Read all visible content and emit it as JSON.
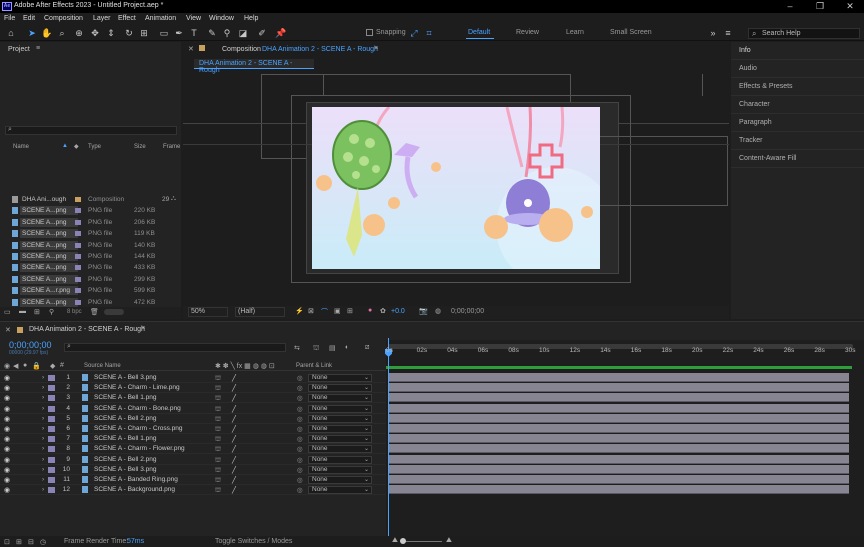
{
  "app": {
    "title": "Adobe After Effects 2023 - Untitled Project.aep *",
    "logo_text": "Ae"
  },
  "menu": [
    "File",
    "Edit",
    "Composition",
    "Layer",
    "Effect",
    "Animation",
    "View",
    "Window",
    "Help"
  ],
  "toolbar": {
    "snapping_label": "Snapping",
    "workspaces": [
      "Default",
      "Review",
      "Learn",
      "Small Screen"
    ],
    "active_workspace": "Default",
    "search_placeholder": "Search Help"
  },
  "project": {
    "title": "Project",
    "columns": {
      "name": "Name",
      "type": "Type",
      "size": "Size",
      "frame": "Frame"
    },
    "items": [
      {
        "name": "DHA Ani...ough",
        "type": "Composition",
        "size": "",
        "frame": "29",
        "kind": "comp"
      },
      {
        "name": "SCENE A...png",
        "type": "PNG file",
        "size": "220 KB",
        "frame": "",
        "kind": "png"
      },
      {
        "name": "SCENE A...png",
        "type": "PNG file",
        "size": "206 KB",
        "frame": "",
        "kind": "png"
      },
      {
        "name": "SCENE A...png",
        "type": "PNG file",
        "size": "119 KB",
        "frame": "",
        "kind": "png"
      },
      {
        "name": "SCENE A...png",
        "type": "PNG file",
        "size": "140 KB",
        "frame": "",
        "kind": "png"
      },
      {
        "name": "SCENE A...png",
        "type": "PNG file",
        "size": "144 KB",
        "frame": "",
        "kind": "png"
      },
      {
        "name": "SCENE A...png",
        "type": "PNG file",
        "size": "433 KB",
        "frame": "",
        "kind": "png"
      },
      {
        "name": "SCENE A...png",
        "type": "PNG file",
        "size": "299 KB",
        "frame": "",
        "kind": "png"
      },
      {
        "name": "SCENE A...r.png",
        "type": "PNG file",
        "size": "599 KB",
        "frame": "",
        "kind": "png"
      },
      {
        "name": "SCENE A...png",
        "type": "PNG file",
        "size": "472 KB",
        "frame": "",
        "kind": "png"
      }
    ],
    "bpc": "8 bpc"
  },
  "composition": {
    "panel_prefix": "Composition",
    "panel_name": "DHA Animation 2 - SCENE A - Rough",
    "tab_label": "DHA Animation 2 - SCENE A - Rough",
    "zoom": "50%",
    "resolution": "(Half)",
    "exposure": "+0.0",
    "timecode": "0;00;00;00"
  },
  "info_panel": {
    "items": [
      "Info",
      "Audio",
      "Effects & Presets",
      "Character",
      "Paragraph",
      "Tracker",
      "Content-Aware Fill"
    ]
  },
  "timeline": {
    "tab_label": "DHA Animation 2 - SCENE A - Rough",
    "timecode": "0;00;00;00",
    "fps": "00000 (29.97 fps)",
    "columns": {
      "source": "Source Name",
      "parent": "Parent & Link"
    },
    "ruler": [
      "0s",
      "02s",
      "04s",
      "06s",
      "08s",
      "10s",
      "12s",
      "14s",
      "16s",
      "18s",
      "20s",
      "22s",
      "24s",
      "26s",
      "28s",
      "30s"
    ],
    "layers": [
      {
        "num": "1",
        "name": "SCENE A - Bell 3.png",
        "parent": "None"
      },
      {
        "num": "2",
        "name": "SCENE A - Charm - Lime.png",
        "parent": "None"
      },
      {
        "num": "3",
        "name": "SCENE A - Bell 1.png",
        "parent": "None"
      },
      {
        "num": "4",
        "name": "SCENE A - Charm - Bone.png",
        "parent": "None"
      },
      {
        "num": "5",
        "name": "SCENE A - Bell 2.png",
        "parent": "None"
      },
      {
        "num": "6",
        "name": "SCENE A - Charm - Cross.png",
        "parent": "None"
      },
      {
        "num": "7",
        "name": "SCENE A - Bell 1.png",
        "parent": "None"
      },
      {
        "num": "8",
        "name": "SCENE A - Charm - Flower.png",
        "parent": "None"
      },
      {
        "num": "9",
        "name": "SCENE A - Bell 2.png",
        "parent": "None"
      },
      {
        "num": "10",
        "name": "SCENE A - Bell 3.png",
        "parent": "None"
      },
      {
        "num": "11",
        "name": "SCENE A - Banded Ring.png",
        "parent": "None"
      },
      {
        "num": "12",
        "name": "SCENE A - Background.png",
        "parent": "None"
      }
    ]
  },
  "status": {
    "render_label": "Frame Render Time:",
    "render_value": "57ms",
    "toggle_label": "Toggle Switches / Modes"
  },
  "colors": {
    "accent": "#2d8ceb",
    "label_lavender": "#8a83b5",
    "layer_bar": "#878592"
  }
}
